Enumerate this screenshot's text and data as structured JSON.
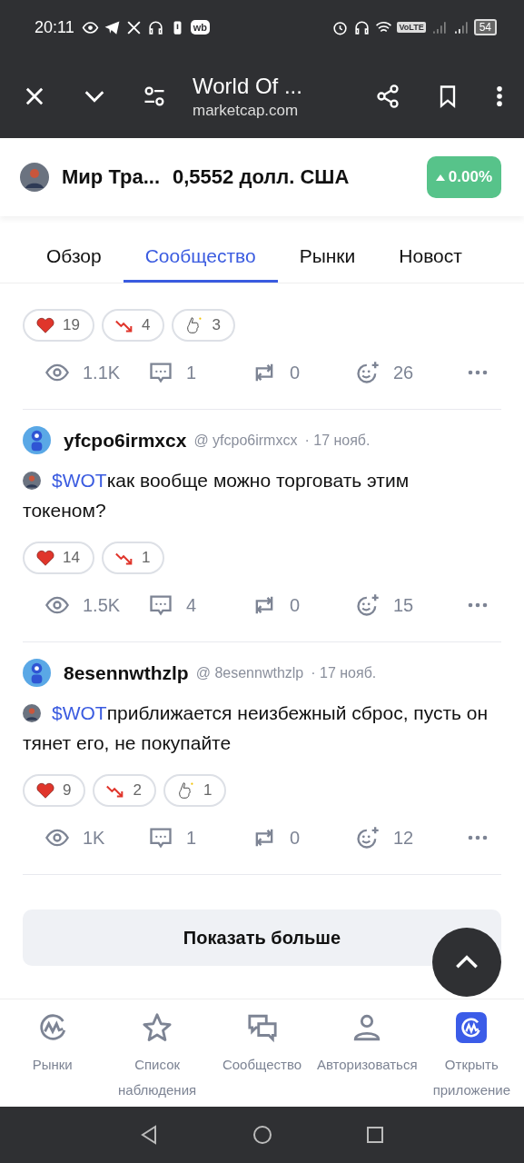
{
  "status_bar": {
    "time": "20:11",
    "app_badge": "wb",
    "network_badge": "VoLTE",
    "battery": "54"
  },
  "browser": {
    "title": "World Of ...",
    "url": "marketcap.com"
  },
  "token": {
    "name": "Мир Тра...",
    "price": "0,5552 долл. США",
    "change": "0.00%"
  },
  "tabs": [
    {
      "label": "Обзор",
      "selected": false
    },
    {
      "label": "Сообщество",
      "selected": true
    },
    {
      "label": "Рынки",
      "selected": false
    },
    {
      "label": "Новост",
      "selected": false
    }
  ],
  "posts": [
    {
      "reactions": [
        {
          "kind": "heart",
          "count": "19"
        },
        {
          "kind": "bearish",
          "count": "4"
        },
        {
          "kind": "clap",
          "count": "3"
        }
      ],
      "stats": {
        "views": "1.1K",
        "comments": "1",
        "reposts": "0",
        "likes": "26"
      }
    },
    {
      "author": "yfcpo6irmxcx",
      "handle": "@ yfcpo6irmxcx",
      "date": "· 17 нояб.",
      "ticker": "$WOT",
      "text": "как вообще можно торговать этим токеном?",
      "reactions": [
        {
          "kind": "heart",
          "count": "14"
        },
        {
          "kind": "bearish",
          "count": "1"
        }
      ],
      "stats": {
        "views": "1.5K",
        "comments": "4",
        "reposts": "0",
        "likes": "15"
      }
    },
    {
      "author": "8esennwthzlp",
      "handle": "@ 8esennwthzlp",
      "date": "· 17 нояб.",
      "ticker": "$WOT",
      "text": "приближается неизбежный сброс, пусть он тянет его, не покупайте",
      "reactions": [
        {
          "kind": "heart",
          "count": "9"
        },
        {
          "kind": "bearish",
          "count": "2"
        },
        {
          "kind": "clap",
          "count": "1"
        }
      ],
      "stats": {
        "views": "1K",
        "comments": "1",
        "reposts": "0",
        "likes": "12"
      }
    }
  ],
  "show_more": "Показать больше",
  "bottom_nav": [
    {
      "kind": "logo",
      "label": "Рынки"
    },
    {
      "kind": "star",
      "label": "Список наблюдения"
    },
    {
      "kind": "chat",
      "label": "Сообщество"
    },
    {
      "kind": "user",
      "label": "Авторизоваться"
    },
    {
      "kind": "app",
      "label": "Открыть приложение"
    }
  ]
}
